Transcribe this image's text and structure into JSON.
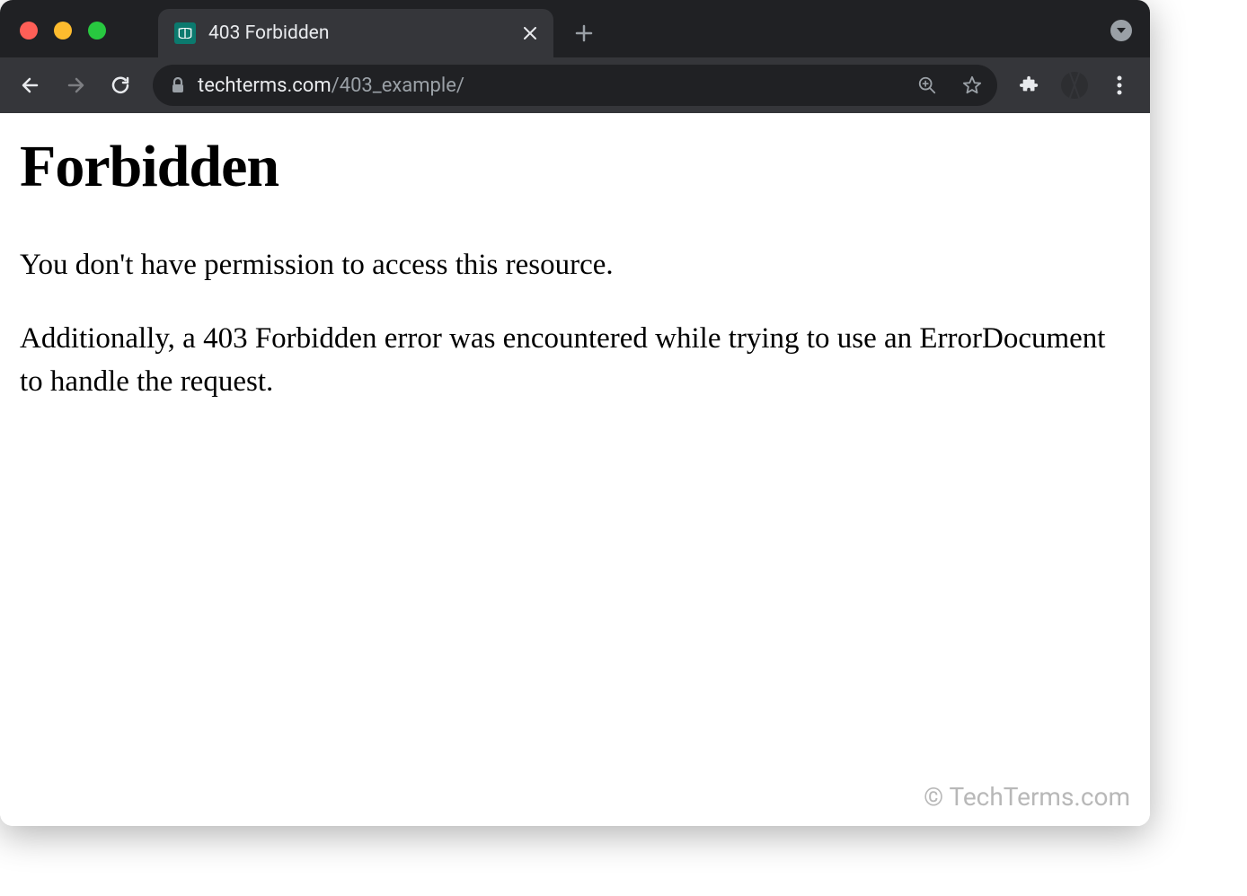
{
  "browser": {
    "tab": {
      "title": "403 Forbidden"
    },
    "url": {
      "domain": "techterms.com",
      "path": "/403_example/"
    }
  },
  "page": {
    "heading": "Forbidden",
    "paragraph1": "You don't have permission to access this resource.",
    "paragraph2": "Additionally, a 403 Forbidden error was encountered while trying to use an ErrorDocument to handle the request."
  },
  "watermark": "© TechTerms.com"
}
